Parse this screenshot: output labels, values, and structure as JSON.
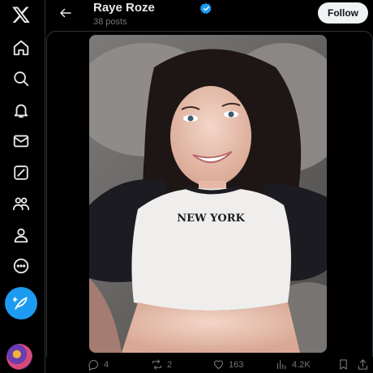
{
  "header": {
    "profile_name": "Raye Roze",
    "posts_count": "38 posts",
    "follow_label": "Follow"
  },
  "sidebar": {
    "items": [
      {
        "icon": "x-logo-icon"
      },
      {
        "icon": "home-icon"
      },
      {
        "icon": "search-icon"
      },
      {
        "icon": "notifications-icon"
      },
      {
        "icon": "messages-icon"
      },
      {
        "icon": "grok-icon"
      },
      {
        "icon": "communities-icon"
      },
      {
        "icon": "profile-icon"
      },
      {
        "icon": "more-icon"
      },
      {
        "icon": "post-feather-icon"
      }
    ]
  },
  "media": {
    "shirt_text": "NEW YORK"
  },
  "actions": {
    "replies": "4",
    "reposts": "2",
    "likes": "163",
    "views": "4.2K"
  },
  "colors": {
    "background": "#000000",
    "accent": "#1d9bf0",
    "text_primary": "#e7e9ea",
    "text_secondary": "#71767b",
    "follow_button": "#eff3f4"
  }
}
